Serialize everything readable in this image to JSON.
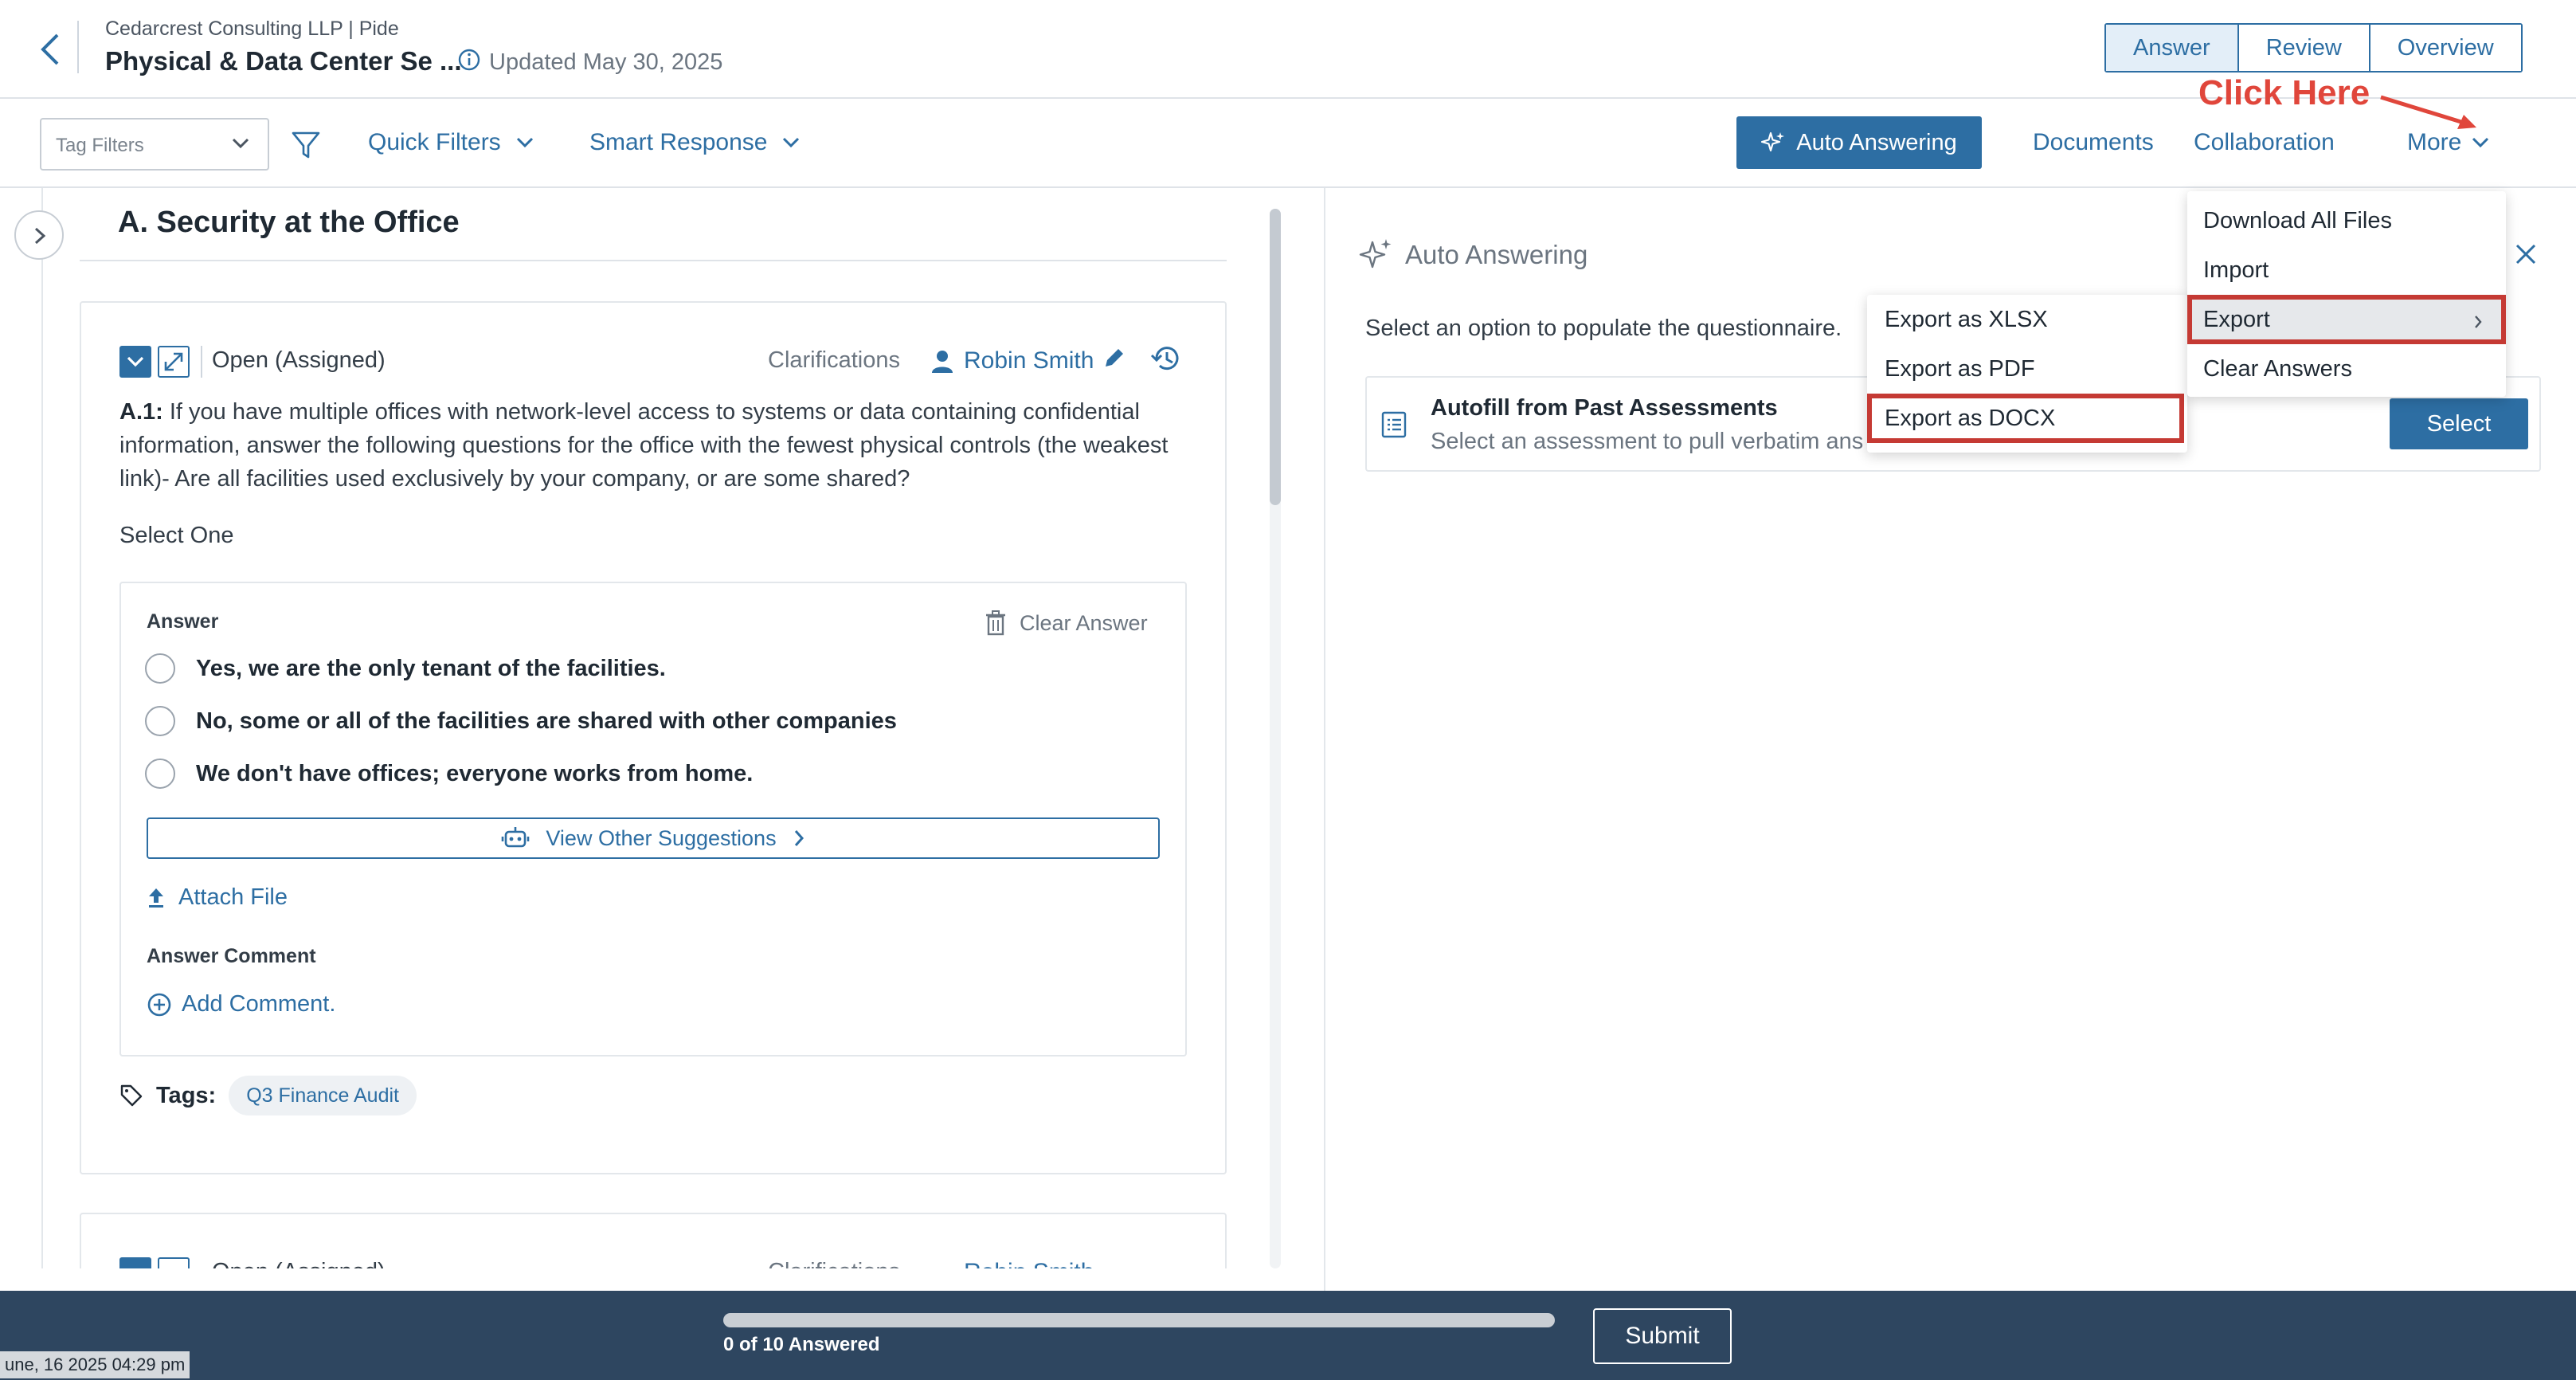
{
  "header": {
    "company": "Cedarcrest Consulting LLP | Pide",
    "title": "Physical & Data Center Se ...",
    "updated": "Updated May 30, 2025",
    "view_tabs": [
      "Answer",
      "Review",
      "Overview"
    ],
    "active_view": "Answer"
  },
  "toolbar": {
    "tag_filters_placeholder": "Tag Filters",
    "quick_filters": "Quick Filters",
    "smart_response": "Smart Response",
    "auto_answering": "Auto Answering",
    "documents": "Documents",
    "collaboration": "Collaboration",
    "more": "More"
  },
  "annotation": {
    "text": "Click Here",
    "color": "#e0463b"
  },
  "section": {
    "title": "A. Security at the Office"
  },
  "question": {
    "status": "Open (Assigned)",
    "clarifications": "Clarifications",
    "assignee": "Robin Smith",
    "id": "A.1:",
    "text": "If you have multiple offices with network-level access to systems or data containing confidential information, answer the following questions for the office with the fewest physical controls (the weakest link)- Are all facilities used exclusively by your company, or are some shared?",
    "select_type": "Select One",
    "answer_label": "Answer",
    "clear_answer": "Clear Answer",
    "options": [
      "Yes, we are the only tenant of the facilities.",
      "No, some or all of the facilities are shared with other companies",
      "We don't have offices; everyone works from home."
    ],
    "view_other_suggestions": "View Other Suggestions",
    "attach_file": "Attach File",
    "answer_comment_label": "Answer Comment",
    "add_comment": "Add Comment.",
    "tags_label": "Tags:",
    "tags": [
      "Q3 Finance Audit"
    ]
  },
  "question2": {
    "status": "Open (Assigned)",
    "clarifications": "Clarifications",
    "assignee": "Robin Smith"
  },
  "auto_panel": {
    "title": "Auto Answering",
    "instruction": "Select an option to populate the questionnaire.",
    "autofill_title": "Autofill from Past Assessments",
    "autofill_sub": "Select an assessment to pull verbatim ans",
    "select": "Select"
  },
  "more_menu": {
    "items": [
      "Download All Files",
      "Import",
      "Export",
      "Clear Answers"
    ],
    "highlighted": "Export"
  },
  "export_menu": {
    "items": [
      "Export as XLSX",
      "Export as PDF",
      "Export as DOCX"
    ],
    "highlighted": "Export as DOCX"
  },
  "footer": {
    "answered_count": 0,
    "total": 10,
    "answered_text": "0 of 10 Answered",
    "submit": "Submit",
    "timestamp": "une, 16 2025 04:29 pm"
  },
  "colors": {
    "brand": "#2d6ea3",
    "footer_bg": "#2e4660",
    "highlight_border": "#c53a34"
  }
}
